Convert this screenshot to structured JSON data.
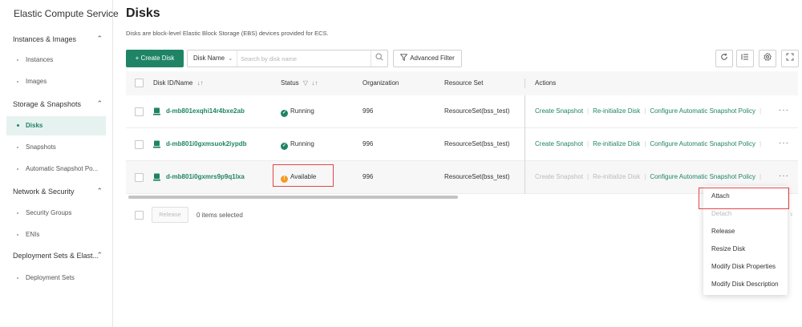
{
  "sidebar": {
    "title": "Elastic Compute Service",
    "groups": [
      {
        "label": "Instances & Images",
        "items": [
          "Instances",
          "Images"
        ]
      },
      {
        "label": "Storage & Snapshots",
        "items": [
          "Disks",
          "Snapshots",
          "Automatic Snapshot Po..."
        ]
      },
      {
        "label": "Network & Security",
        "items": [
          "Security Groups",
          "ENIs"
        ]
      },
      {
        "label": "Deployment Sets & Elast...",
        "items": [
          "Deployment Sets"
        ]
      }
    ],
    "active_item": "Disks"
  },
  "page": {
    "title": "Disks",
    "description": "Disks are block-level Elastic Block Storage (EBS) devices provided for ECS."
  },
  "toolbar": {
    "create_label": "+ Create Disk",
    "search_field": "Disk Name",
    "search_placeholder": "Search by disk name",
    "filter_label": "Advanced Filter"
  },
  "table": {
    "headers": {
      "id": "Disk ID/Name",
      "status": "Status",
      "org": "Organization",
      "resource_set": "Resource Set",
      "actions": "Actions"
    },
    "rows": [
      {
        "id": "d-mb801exqhi14r4bxe2ab",
        "status": "Running",
        "org": "996",
        "resource_set": "ResourceSet(bss_test)"
      },
      {
        "id": "d-mb801i0gxmsuok2iypdb",
        "status": "Running",
        "org": "996",
        "resource_set": "ResourceSet(bss_test)"
      },
      {
        "id": "d-mb801i0gxmrs9p9q1lxa",
        "status": "Available",
        "org": "996",
        "resource_set": "ResourceSet(bss_test)"
      }
    ],
    "actions": {
      "create_snapshot": "Create Snapshot",
      "reinit": "Re-initialize Disk",
      "auto_policy": "Configure Automatic Snapshot Policy",
      "more": "···"
    }
  },
  "footer": {
    "release_label": "Release",
    "selected_text": "0 items selected"
  },
  "dropdown": {
    "items": [
      {
        "label": "Attach",
        "disabled": false
      },
      {
        "label": "Detach",
        "disabled": true
      },
      {
        "label": "Release",
        "disabled": false
      },
      {
        "label": "Resize Disk",
        "disabled": false
      },
      {
        "label": "Modify Disk Properties",
        "disabled": false
      },
      {
        "label": "Modify Disk Description",
        "disabled": false
      }
    ]
  },
  "colors": {
    "accent": "#1f8466",
    "warning": "#f59a23",
    "highlight": "#e54545"
  }
}
